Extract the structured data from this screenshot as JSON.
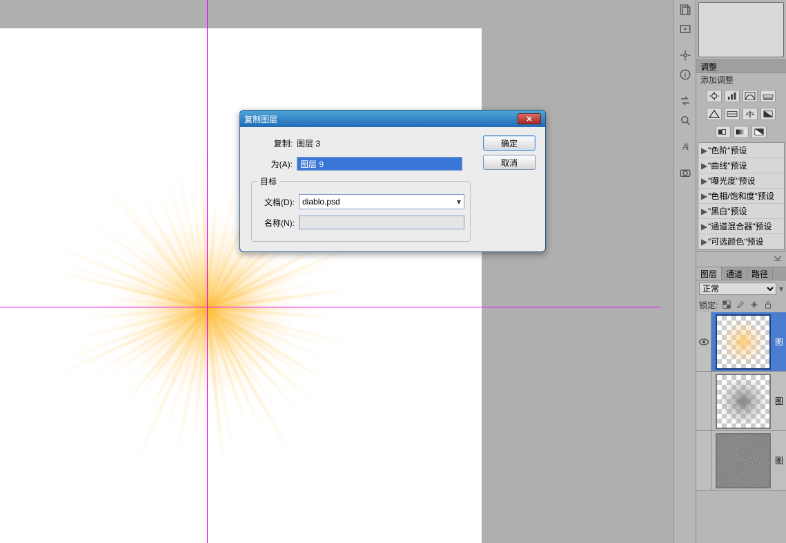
{
  "dialog": {
    "title": "复制图层",
    "copy_label": "复制:",
    "copy_value": "图层 3",
    "as_label": "为(A):",
    "as_value": "图层 9",
    "group_label": "目标",
    "doc_label": "文档(D):",
    "doc_value": "diablo.psd",
    "name_label": "名称(N):",
    "name_value": "",
    "ok_label": "确定",
    "cancel_label": "取消",
    "close_glyph": "✕"
  },
  "adjustments": {
    "panel_title": "调整",
    "add_label": "添加调整",
    "presets": [
      "\"色阶\"预设",
      "\"曲线\"预设",
      "\"曝光度\"预设",
      "\"色相/饱和度\"预设",
      "\"黑白\"预设",
      "\"通道混合器\"预设",
      "\"可选颜色\"预设"
    ]
  },
  "layers_panel": {
    "tabs": {
      "layers": "图层",
      "channels": "通道",
      "paths": "路径"
    },
    "blend_mode": "正常",
    "lock_label": "锁定:",
    "layers": [
      {
        "name": "图",
        "kind": "burst",
        "visible": true,
        "selected": true
      },
      {
        "name": "图",
        "kind": "gray",
        "visible": false,
        "selected": false
      },
      {
        "name": "图",
        "kind": "noise",
        "visible": false,
        "selected": false
      }
    ]
  },
  "strip_icons": [
    "history",
    "slideshow",
    "clone-stamp",
    "info",
    "swap",
    "dodge",
    "type",
    "camera"
  ]
}
